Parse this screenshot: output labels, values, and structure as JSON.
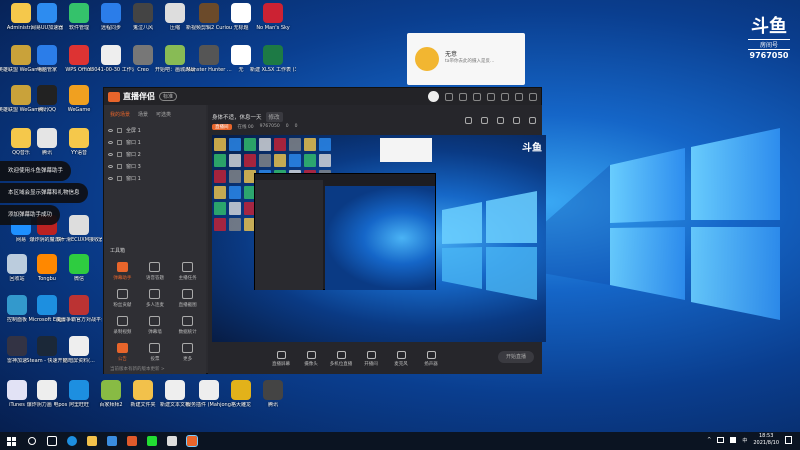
{
  "desktop": {
    "icons": [
      {
        "label": "Administr...",
        "color": "#f5c84b"
      },
      {
        "label": "网易UU加速器",
        "color": "#2d8cf0"
      },
      {
        "label": "软件管理",
        "color": "#34c26b"
      },
      {
        "label": "远程同步",
        "color": "#2b7de9"
      },
      {
        "label": "鬼泣八风",
        "color": "#444"
      },
      {
        "label": "压缩",
        "color": "#ddd"
      },
      {
        "label": "新视频剪辑2 Curious Ex...",
        "color": "#6b4a2a"
      },
      {
        "label": "无标题",
        "color": "#fff"
      },
      {
        "label": "No Man's Sky",
        "color": "#c23"
      },
      {
        "label": "英雄联盟 WeGame版",
        "color": "#c9a23a"
      },
      {
        "label": "电脑管家",
        "color": "#2b7de9"
      },
      {
        "label": "WPS Office",
        "color": "#d33"
      },
      {
        "label": "Y3041-00-30 工作清单(...",
        "color": "#eee"
      },
      {
        "label": "Creo",
        "color": "#777"
      },
      {
        "label": "开始吧：画城再战",
        "color": "#8b5"
      },
      {
        "label": "Monster Hunter ...",
        "color": "#555"
      },
      {
        "label": "无",
        "color": "#fff"
      },
      {
        "label": "新建 XLSX 工作表 (3)",
        "color": "#1d7a45"
      },
      {
        "label": "英雄联盟 WeGame版",
        "color": "#c9a23a"
      },
      {
        "label": "腾讯QQ",
        "color": "#222"
      },
      {
        "label": "WeGame",
        "color": "#f0a020"
      },
      {
        "label": "QQ音乐",
        "color": "#f5c84b"
      },
      {
        "label": "腾讯",
        "color": "#e5e5e5"
      },
      {
        "label": "YY语音",
        "color": "#f5c84b"
      },
      {
        "label": "网易",
        "color": "#1e90ff"
      },
      {
        "label": "爆炸阴的魔法师",
        "color": "#b22"
      },
      {
        "label": "铁一滑ECUXM接收器第...",
        "color": "#ddd"
      },
      {
        "label": "回收站",
        "color": "#bcd"
      },
      {
        "label": "Tongbu",
        "color": "#f80"
      },
      {
        "label": "微信",
        "color": "#2ecc40"
      },
      {
        "label": "控制面板",
        "color": "#39c"
      },
      {
        "label": "Microsoft Edge",
        "color": "#1d8fe0"
      },
      {
        "label": "魔兽争霸官方对战平台",
        "color": "#b33"
      },
      {
        "label": "雷神加速",
        "color": "#334"
      },
      {
        "label": "Steam - 快速开始",
        "color": "#1b2838"
      },
      {
        "label": "防暗屏资料(...",
        "color": "#eee"
      },
      {
        "label": "iTunes",
        "color": "#e2e2f5"
      },
      {
        "label": "爆炸阴力画 电pos",
        "color": "#eee"
      },
      {
        "label": "阿里旺旺",
        "color": "#1d8fe0"
      },
      {
        "label": "百家拜拜2",
        "color": "#8b4"
      },
      {
        "label": "新建文件夹",
        "color": "#f2c14b"
      },
      {
        "label": "新建文本文档",
        "color": "#eee"
      },
      {
        "label": "服务插件 (Mahjong...",
        "color": "#eee"
      },
      {
        "label": "格大雕龙",
        "color": "#e2b21a"
      },
      {
        "label": "腾讯",
        "color": "#444"
      }
    ]
  },
  "watermark": {
    "logo": "斗鱼",
    "sub": "房间号",
    "room": "9767050"
  },
  "notification": {
    "name": "无意",
    "desc": "ta带你去此的摄入是反..."
  },
  "app": {
    "title": "直播伴侣",
    "version": "标准",
    "left_tabs": [
      "我的场景",
      "场景",
      "可选类"
    ],
    "layers": [
      "全屏 1",
      "窗口 1",
      "窗口 2",
      "窗口 3",
      "窗口 1"
    ],
    "tools_header": "工具箱",
    "tools": [
      "弹幕助手",
      "语音答题",
      "主播任务",
      "粉丝贡献",
      "多人连麦",
      "直播截图",
      "录制视频",
      "弹幕墙",
      "数据统计",
      "公告",
      "投票",
      "更多"
    ],
    "room_title": "身体不适，休息一天",
    "room_tag": "修改",
    "stats": {
      "label": "直播间",
      "online": "在线 00",
      "fans": "9767050",
      "a": "0",
      "b": "0"
    },
    "controls": [
      "直播屏幕",
      "摄像头",
      "多机位直播",
      "开播间",
      "麦克风",
      "扬声器"
    ],
    "go_live": "开始直播",
    "status": "当前版本有新的版本更新 >"
  },
  "toasts": [
    "欢迎使用斗鱼弹幕助手",
    "本区域会显示弹幕和礼物信息",
    "添加弹幕助手成功"
  ],
  "taskbar": {
    "time": "18:53",
    "date": "2021/8/10",
    "lang": "中"
  }
}
